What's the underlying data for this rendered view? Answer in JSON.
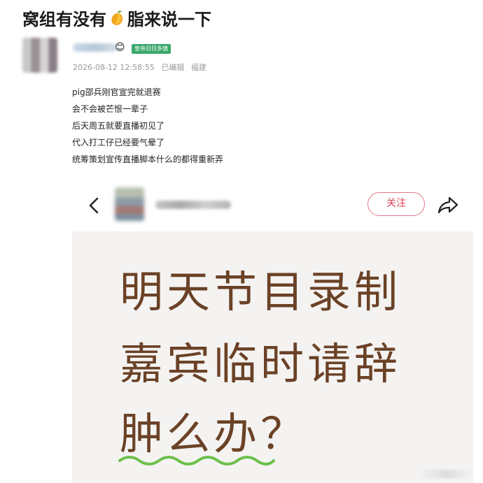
{
  "post": {
    "title_part1": "窝组有没有",
    "title_icon": "mango-icon",
    "title_part2": "脂来说一下",
    "author": {
      "emoji": "😊",
      "badge": "皇帝日日多慎"
    },
    "meta": {
      "datetime": "2026-08-12 12:58:55",
      "edited": "已编辑",
      "location": "福建"
    },
    "lines": [
      "pig邵兵刚官宣完就退赛",
      "会不会被芒恨一辈子",
      "后天周五就要直播初见了",
      "代入打工仔已经要气晕了",
      "统筹策划宣传直播脚本什么的都得重新弄"
    ]
  },
  "embed": {
    "back_icon": "chevron-left-icon",
    "follow_label": "关注",
    "share_icon": "share-icon",
    "image_lines": [
      "明天节目录制",
      "嘉宾临时请辞",
      "肿么办？"
    ],
    "text_color": "#6b4226",
    "underline_color": "#6cc04a"
  }
}
